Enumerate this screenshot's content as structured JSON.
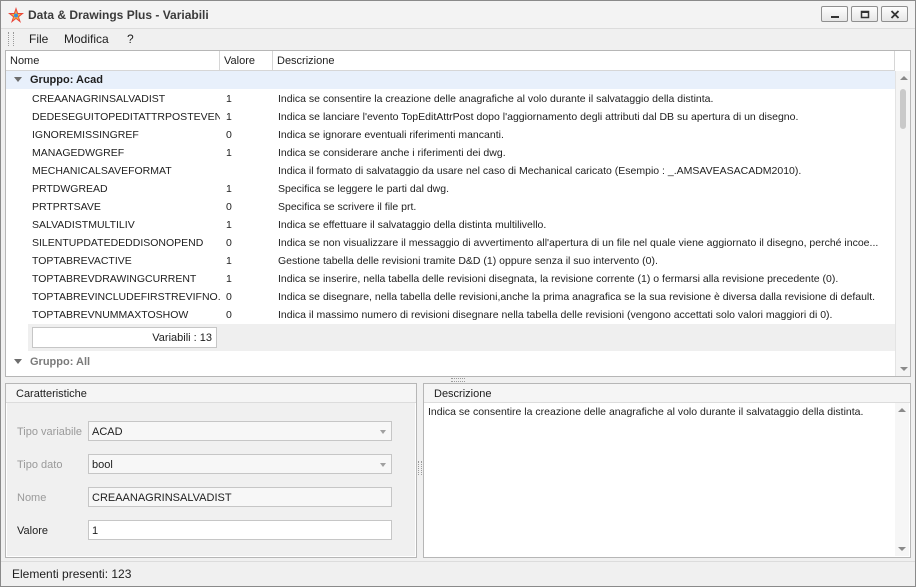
{
  "window": {
    "title": "Data & Drawings Plus - Variabili"
  },
  "menu": [
    "File",
    "Modifica",
    "?"
  ],
  "grid": {
    "columns": [
      "Nome",
      "Valore",
      "Descrizione"
    ],
    "groups": [
      {
        "label": "Gruppo: Acad",
        "rows": [
          {
            "name": "CREAANAGRINSALVADIST",
            "value": "1",
            "desc": "Indica se consentire la creazione delle anagrafiche al volo durante il salvataggio della distinta."
          },
          {
            "name": "DEDESEGUITOPEDITATTRPOSTEVENT",
            "value": "1",
            "desc": "Indica se lanciare l'evento TopEditAttrPost dopo l'aggiornamento degli attributi dal DB su apertura di un disegno."
          },
          {
            "name": "IGNOREMISSINGREF",
            "value": "0",
            "desc": "Indica se ignorare eventuali riferimenti mancanti."
          },
          {
            "name": "MANAGEDWGREF",
            "value": "1",
            "desc": "Indica se considerare anche i riferimenti dei dwg."
          },
          {
            "name": "MECHANICALSAVEFORMAT",
            "value": "",
            "desc": "Indica il formato di salvataggio da usare nel caso di Mechanical caricato (Esempio : _.AMSAVEASACADM2010)."
          },
          {
            "name": "PRTDWGREAD",
            "value": "1",
            "desc": "Specifica se leggere le parti dal dwg."
          },
          {
            "name": "PRTPRTSAVE",
            "value": "0",
            "desc": "Specifica se scrivere il file prt."
          },
          {
            "name": "SALVADISTMULTILIV",
            "value": "1",
            "desc": "Indica se effettuare il salvataggio della distinta multilivello."
          },
          {
            "name": "SILENTUPDATEDEDDISONOPEND",
            "value": "0",
            "desc": "Indica se non visualizzare il messaggio di avvertimento all'apertura di un file nel quale viene aggiornato il disegno, perché incoe..."
          },
          {
            "name": "TOPTABREVACTIVE",
            "value": "1",
            "desc": "Gestione tabella delle revisioni tramite D&D (1) oppure senza il suo intervento (0)."
          },
          {
            "name": "TOPTABREVDRAWINGCURRENT",
            "value": "1",
            "desc": "Indica se inserire, nella tabella delle revisioni disegnata, la revisione corrente (1) o fermarsi alla revisione precedente (0)."
          },
          {
            "name": "TOPTABREVINCLUDEFIRSTREVIFNO...",
            "value": "0",
            "desc": "Indica se disegnare, nella tabella delle revisioni,anche la prima anagrafica se la sua revisione è diversa dalla revisione di default."
          },
          {
            "name": "TOPTABREVNUMMAXTOSHOW",
            "value": "0",
            "desc": "Indica il massimo numero di revisioni disegnare nella tabella delle revisioni (vengono accettati solo valori maggiori di 0)."
          }
        ],
        "footer": "Variabili : 13"
      },
      {
        "label": "Gruppo: All"
      }
    ]
  },
  "caratteristiche": {
    "title": "Caratteristiche",
    "tipo_variabile_label": "Tipo variabile",
    "tipo_variabile_value": "ACAD",
    "tipo_dato_label": "Tipo dato",
    "tipo_dato_value": "bool",
    "nome_label": "Nome",
    "nome_value": "CREAANAGRINSALVADIST",
    "valore_label": "Valore",
    "valore_value": "1"
  },
  "descrizione": {
    "title": "Descrizione",
    "text": "Indica se consentire la creazione delle anagrafiche al volo durante il salvataggio della distinta."
  },
  "status": {
    "text": "Elementi presenti: 123"
  },
  "colors": {
    "group_highlight": "#e8f0fb",
    "window_bg": "#f0f0f0"
  }
}
